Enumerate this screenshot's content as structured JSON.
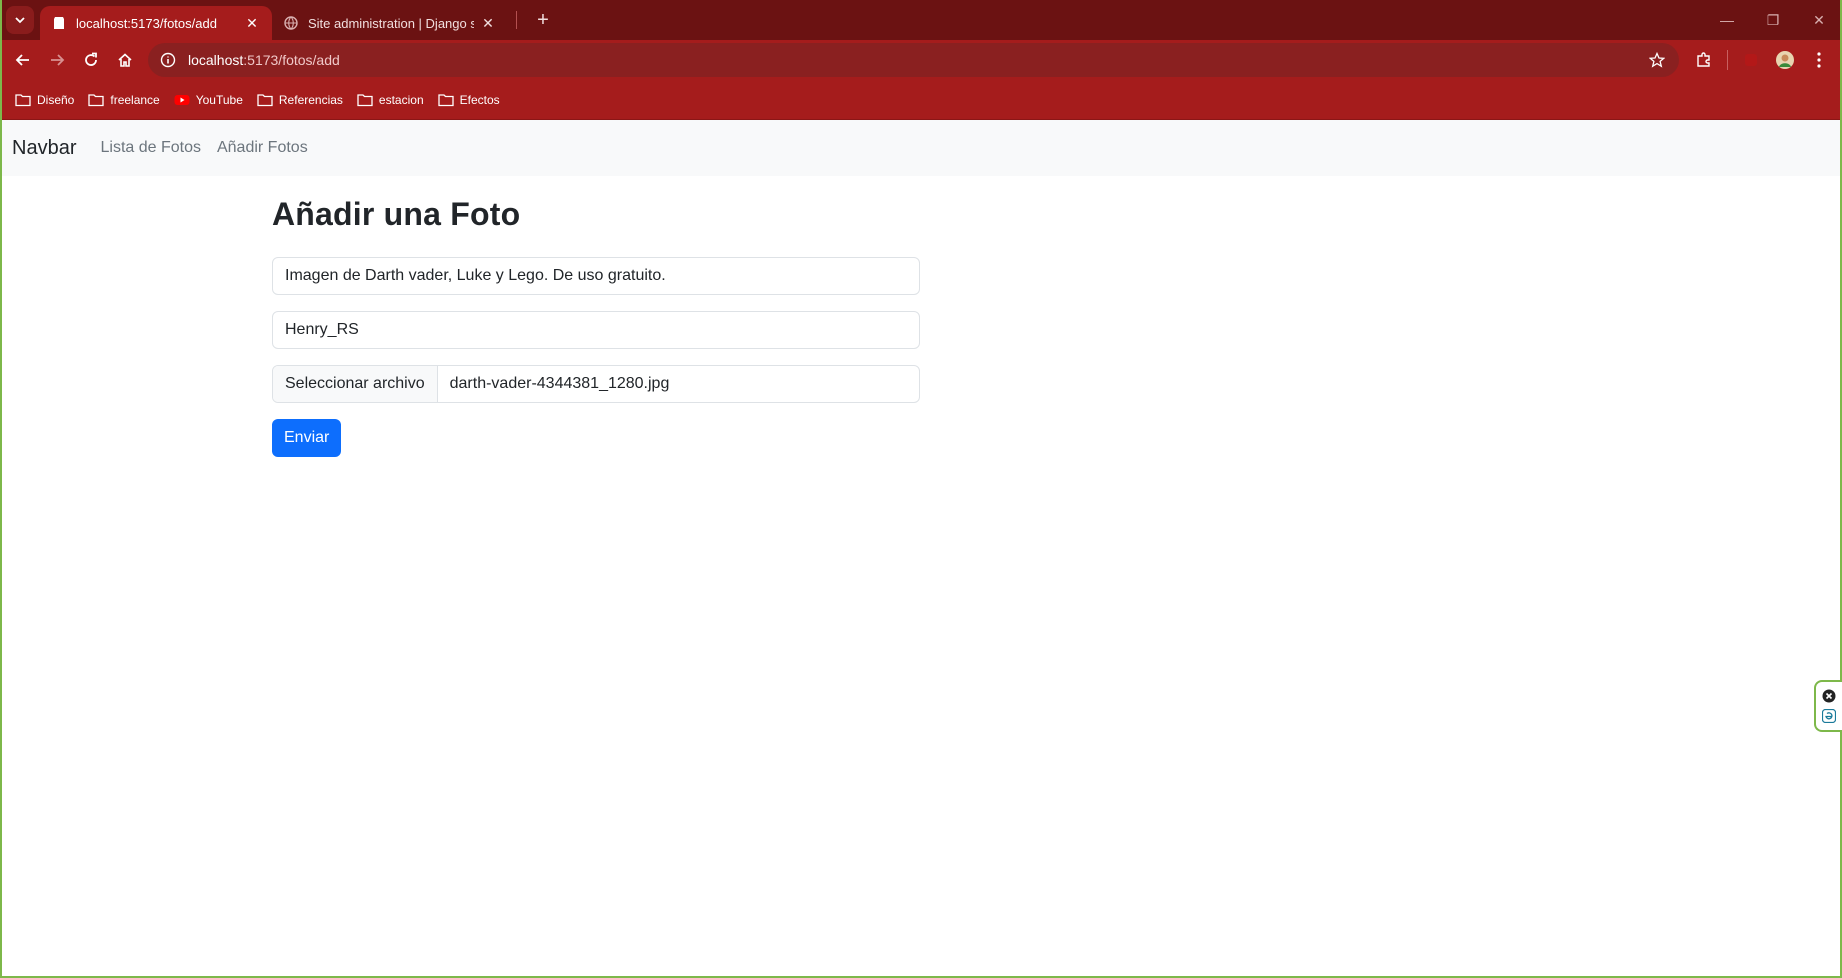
{
  "browser": {
    "tabs": [
      {
        "title": "localhost:5173/fotos/add",
        "active": true
      },
      {
        "title": "Site administration | Django site",
        "active": false
      }
    ],
    "address": {
      "host": "localhost",
      "path": ":5173/fotos/add"
    },
    "bookmarks": [
      {
        "label": "Diseño",
        "icon": "folder-icon"
      },
      {
        "label": "freelance",
        "icon": "folder-icon"
      },
      {
        "label": "YouTube",
        "icon": "youtube-icon"
      },
      {
        "label": "Referencias",
        "icon": "folder-icon"
      },
      {
        "label": "estacion",
        "icon": "folder-icon"
      },
      {
        "label": "Efectos",
        "icon": "folder-icon"
      }
    ]
  },
  "navbar": {
    "brand": "Navbar",
    "links": [
      "Lista de Fotos",
      "Añadir Fotos"
    ]
  },
  "form": {
    "title": "Añadir una Foto",
    "description_value": "Imagen de Darth vader, Luke y Lego. De uso gratuito.",
    "author_value": "Henry_RS",
    "file_button": "Seleccionar archivo",
    "file_name": "darth-vader-4344381_1280.jpg",
    "submit": "Enviar"
  },
  "colors": {
    "tabstrip": "#6b1212",
    "toolbar": "#a51c1c",
    "primary": "#0d6efd",
    "navbar_bg": "#f8f9fa"
  }
}
